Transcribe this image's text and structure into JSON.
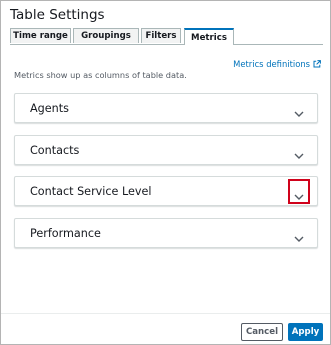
{
  "dialog": {
    "title": "Table Settings"
  },
  "tabs": [
    {
      "label": "Time range",
      "selected": false
    },
    {
      "label": "Groupings",
      "selected": false
    },
    {
      "label": "Filters",
      "selected": false
    },
    {
      "label": "Metrics",
      "selected": true
    }
  ],
  "metrics_link": {
    "label": "Metrics definitions",
    "icon": "external-link-icon"
  },
  "description": "Metrics show up as columns of table data.",
  "sections": [
    {
      "label": "Agents",
      "icon": "chevron-down-icon"
    },
    {
      "label": "Contacts",
      "icon": "chevron-down-icon"
    },
    {
      "label": "Contact Service Level",
      "icon": "chevron-down-icon",
      "highlighted": true
    },
    {
      "label": "Performance",
      "icon": "chevron-down-icon"
    }
  ],
  "footer": {
    "cancel_label": "Cancel",
    "apply_label": "Apply"
  },
  "colors": {
    "accent": "#0073bb",
    "highlight": "#d0021b"
  }
}
